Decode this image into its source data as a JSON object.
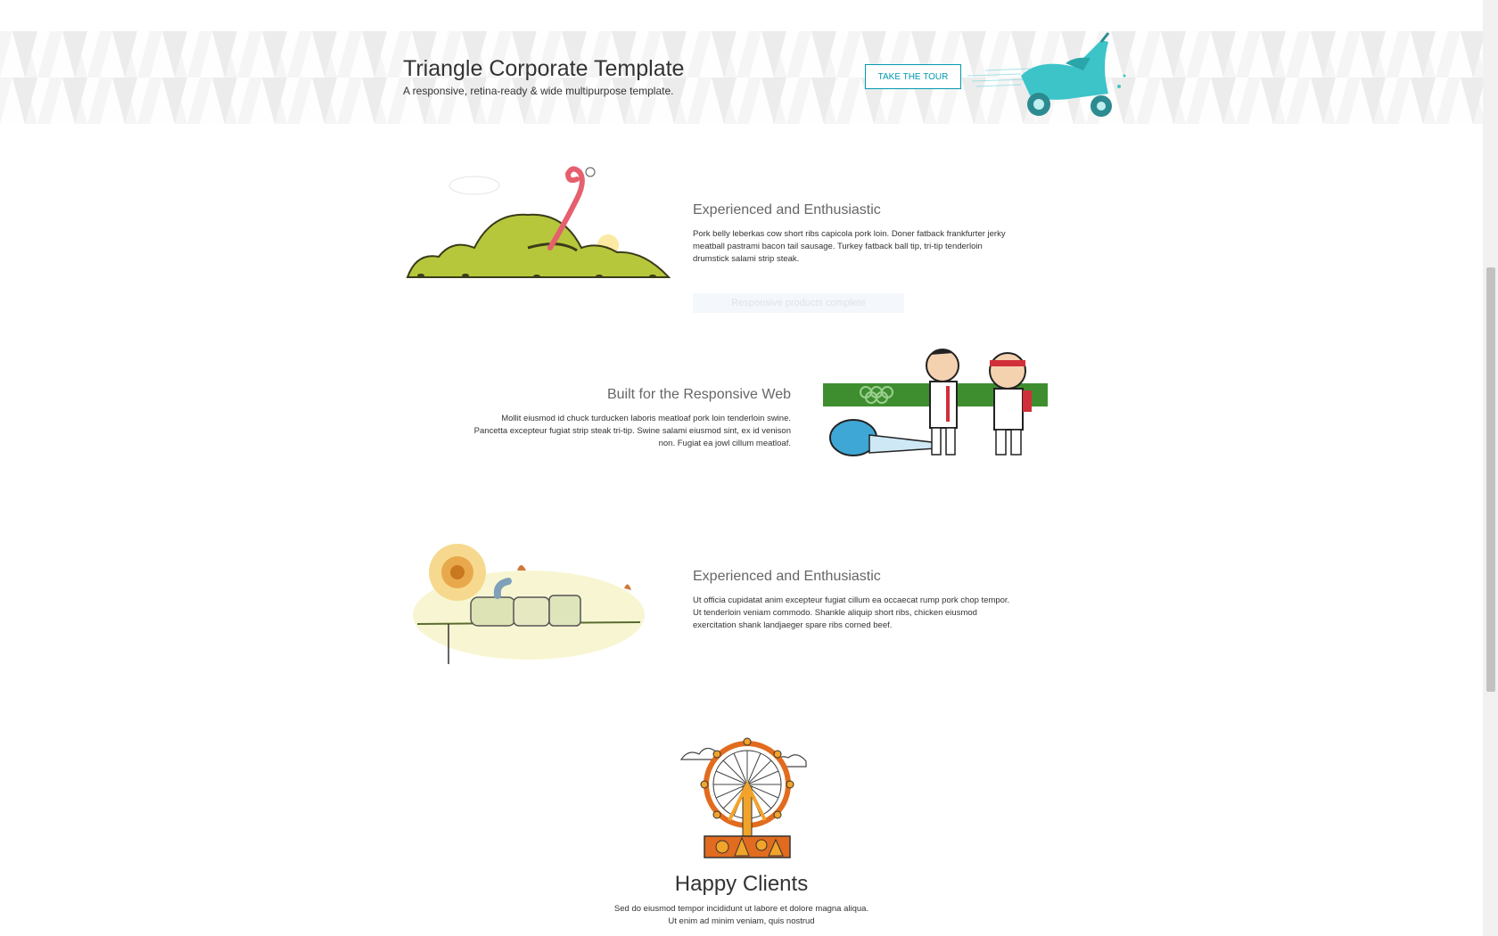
{
  "banner": {
    "title": "Triangle Corporate Template",
    "subtitle": "A responsive, retina-ready & wide multipurpose template.",
    "tour_button": "TAKE THE TOUR",
    "accent": "#0099ae"
  },
  "features": [
    {
      "title": "Experienced and Enthusiastic",
      "text": "Pork belly leberkas cow short ribs capicola pork loin. Doner fatback frankfurter jerky meatball pastrami bacon tail sausage. Turkey fatback ball tip, tri-tip tenderloin drumstick salami strip steak.",
      "button": "Responsive products complete",
      "illustration": "worm-hill-illustration"
    },
    {
      "title": "Built for the Responsive Web",
      "text": "Mollit eiusmod id chuck turducken laboris meatloaf pork loin tenderloin swine. Pancetta excepteur fugiat strip steak tri-tip. Swine salami eiusmod sint, ex id venison non. Fugiat ea jowl cillum meatloaf.",
      "illustration": "karate-illustration"
    },
    {
      "title": "Experienced and Enthusiastic",
      "text": "Ut officia cupidatat anim excepteur fugiat cillum ea occaecat rump pork chop tempor. Ut tenderloin veniam commodo. Shankle aliquip short ribs, chicken eiusmod exercitation shank landjaeger spare ribs corned beef.",
      "illustration": "robot-desert-illustration"
    }
  ],
  "clients": {
    "title": "Happy Clients",
    "text_line1": "Sed do eiusmod tempor incididunt ut labore et dolore magna aliqua.",
    "text_line2": "Ut enim ad minim veniam, quis nostrud",
    "illustration": "ferris-wheel-illustration"
  }
}
